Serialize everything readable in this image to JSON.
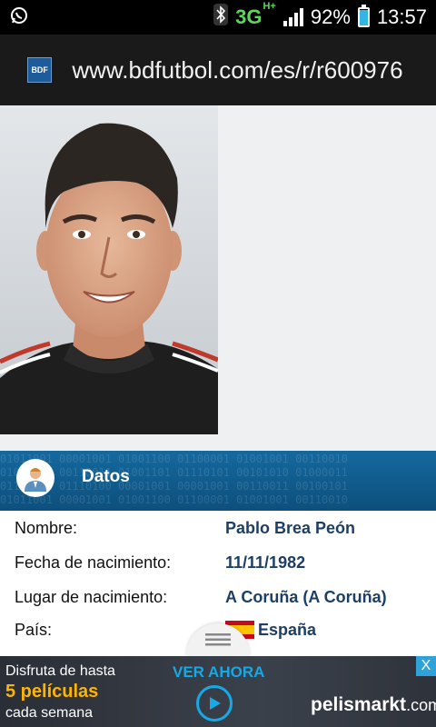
{
  "status_bar": {
    "network": "3G",
    "network_sup": "H+",
    "battery": "92%",
    "battery_level": 0.92,
    "time": "13:57",
    "icons": [
      "whatsapp-icon",
      "bluetooth-icon",
      "signal-icon",
      "battery-icon"
    ]
  },
  "browser": {
    "favicon_text": "BDF",
    "url": "www.bdfutbol.com/es/r/r600976"
  },
  "profile": {
    "section_title": "Datos",
    "binary_bg": [
      "01011001 00001001 01001100 01100001 01001001 00110010",
      "01000101 00110011 01001101 01110101 00101010 01000011",
      "01100001 01110100 00001001 00001001 00110011 00100101"
    ],
    "rows": [
      {
        "label": "Nombre:",
        "value": "Pablo Brea Peón"
      },
      {
        "label": "Fecha de nacimiento:",
        "value": "11/11/1982"
      },
      {
        "label": "Lugar de nacimiento:",
        "value": "A Coruña (A Coruña)"
      },
      {
        "label": "País:",
        "value": "España"
      }
    ]
  },
  "ad": {
    "line1": "Disfruta de hasta",
    "line2": "5 películas",
    "line3": "cada semana",
    "cta": "VER AHORA",
    "brand": "pelismarkt",
    "brand_tld": ".com",
    "close": "X"
  },
  "colors": {
    "header_blue": "#15699f",
    "value_text": "#1d3f66",
    "ad_accent": "#17a9e6",
    "ad_highlight": "#ffb400"
  }
}
